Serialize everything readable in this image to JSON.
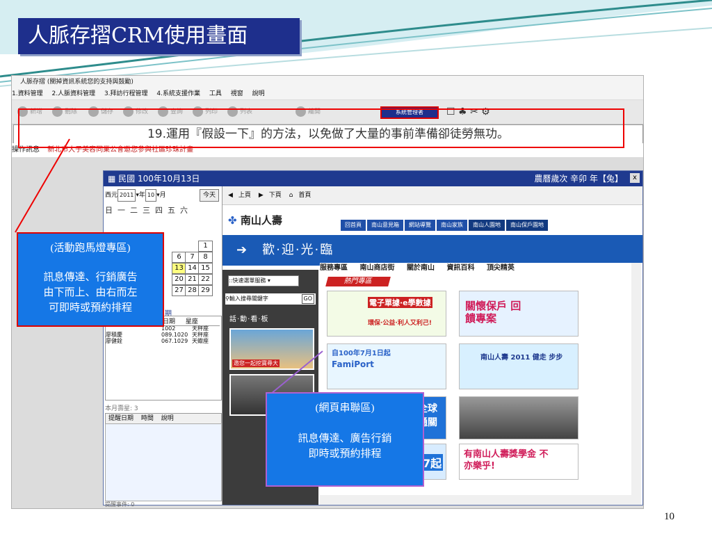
{
  "slide": {
    "title": "人脈存摺CRM使用畫面",
    "page_number": "10"
  },
  "app": {
    "title": "人脈存摺 (關掉資訊系統您的支持與鼓勵)",
    "menu": [
      "1.資料管理",
      "2.人脈資料管理",
      "3.拜訪行程管理",
      "4.系統支援作業",
      "工具",
      "視窗",
      "說明"
    ],
    "toolbar": [
      "新增",
      "刪除",
      "儲存",
      "修改",
      "查詢",
      "列印",
      "列表",
      "離開"
    ],
    "system_button": "系統管理者",
    "marquee_text": "19.運用『假設一下』的方法，以免做了大量的事前準備卻徒勞無功。",
    "op_label": "操作訊息",
    "op_message": "新北市大子美容同業公會邀您參與社區珍珠計畫"
  },
  "inner_window": {
    "title": "民國 100年10月13日",
    "lunar": "農曆歲次 辛卯 年【兔】",
    "close": "x"
  },
  "calendar": {
    "prefix": "西元",
    "year": "2011",
    "year_unit": "年",
    "month": "10",
    "month_unit": "月",
    "today": "今天",
    "weekdays": "日一二三四五六",
    "days": [
      {
        "d": "1",
        "sel": false
      },
      {
        "d": "6",
        "sel": false
      },
      {
        "d": "7",
        "sel": false
      },
      {
        "d": "8",
        "sel": false
      },
      {
        "d": "13",
        "sel": true
      },
      {
        "d": "14",
        "sel": false
      },
      {
        "d": "15",
        "sel": false
      },
      {
        "d": "20",
        "sel": false
      },
      {
        "d": "21",
        "sel": false
      },
      {
        "d": "22",
        "sel": false
      },
      {
        "d": "27",
        "sel": false
      },
      {
        "d": "28",
        "sel": false
      },
      {
        "d": "29",
        "sel": false
      }
    ],
    "list_partial": "期",
    "list_headers": [
      "日期",
      "星座"
    ],
    "list_rows": [
      {
        "name": "",
        "date": "1002",
        "sign": "天秤座"
      },
      {
        "name": "廖積慶",
        "date": "089.1020",
        "sign": "天秤座"
      },
      {
        "name": "廖健銓",
        "date": "067.1029",
        "sign": "天蠍座"
      }
    ],
    "month_count": "本月壽星: 3",
    "reminder_headers": [
      "提醒日期",
      "時間",
      "說明"
    ],
    "reminder_count": "提醒事件: 0"
  },
  "browser": {
    "nav": [
      "上頁",
      "下頁",
      "首頁"
    ],
    "logo": "南山人壽",
    "top_tabs": [
      "回首頁",
      "南山意見箱",
      "網站導覽",
      "南山家族",
      "南山人園地",
      "南山保戶園地"
    ],
    "welcome": "歡·迎·光·臨",
    "quick_menu": "::快速選單服務",
    "search_placeholder": "輸入搜尋關鍵字",
    "search_go": "GO",
    "sidebar_label": "話·動·看·板",
    "thumb_caption": "邀您一起挖寶尋大",
    "menu": [
      "服務專區",
      "南山商店街",
      "關於南山",
      "資訊百科",
      "頂尖精英"
    ],
    "hot_label": "熱門專區",
    "ad1_text": "電子單據·e學數據",
    "ad1_sub": "環保·公益·利人又利己!",
    "ad2_text": "關懷保戶 回饋專案",
    "ad3_text": "自100年7月1日起",
    "ad3_sub": "FamiPort",
    "ad4_text": "南山人壽 2011 健走 步步",
    "ad5_text": "全球 通關",
    "ad6_text": "6/7起",
    "ad7_text": "有南山人壽獎學金 不亦樂乎!"
  },
  "annotations": {
    "callout1_title": "(活動跑馬燈專區)",
    "callout1_line1": "訊息傳達、行銷廣告",
    "callout1_line2": "由下而上、由右而左",
    "callout1_line3": "可即時或預約排程",
    "callout2_title": "(網頁串聯區)",
    "callout2_line1": "訊息傳達、廣告行銷",
    "callout2_line2": "即時或預約排程"
  }
}
